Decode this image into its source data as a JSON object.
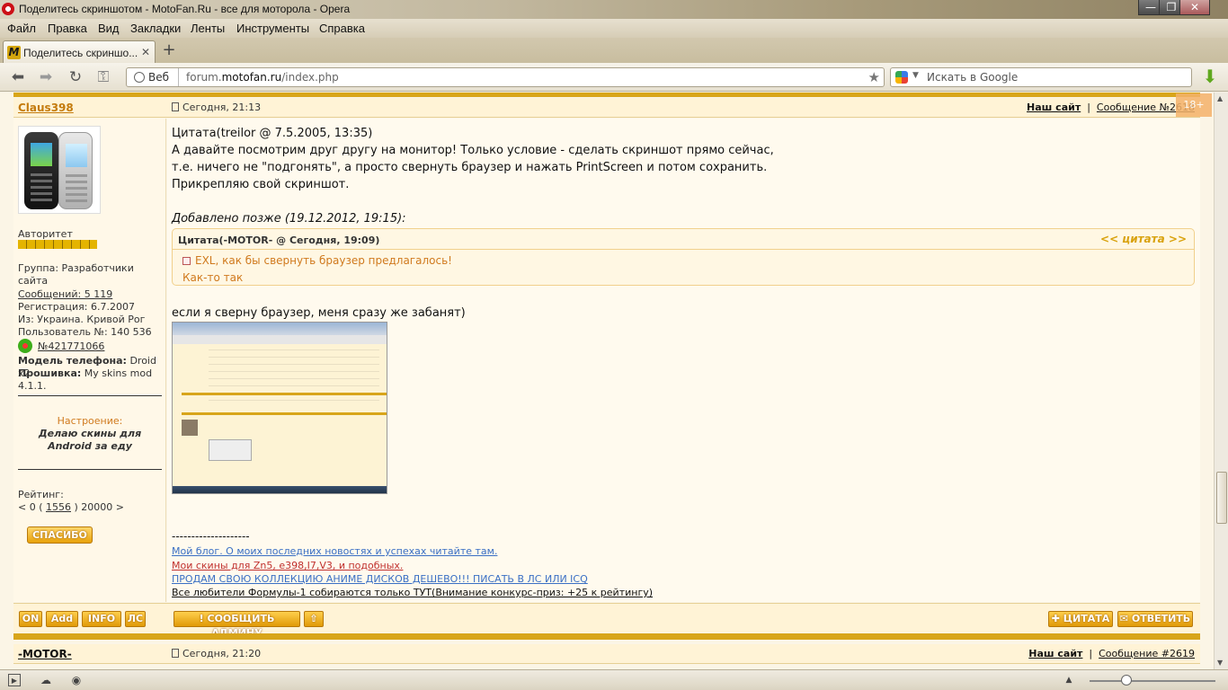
{
  "window": {
    "title": "Поделитесь скриншотом - MotoFan.Ru - все для моторола - Opera"
  },
  "menu": [
    "Файл",
    "Правка",
    "Вид",
    "Закладки",
    "Ленты",
    "Инструменты",
    "Справка"
  ],
  "tab": {
    "label": "Поделитесь скриншо...",
    "favicon_letter": "M"
  },
  "address": {
    "mode": "Веб",
    "url_prefix": "forum.",
    "url_domain": "motofan.ru",
    "url_path": "/index.php"
  },
  "search": {
    "placeholder": "Искать в Google"
  },
  "badge": "18+",
  "post1": {
    "author": "Claus398",
    "date": "Сегодня, 21:13",
    "site_link": "Наш сайт",
    "message_num": "Сообщение №2618",
    "rank_label": "Авторитет",
    "group": "Группа: Разработчики сайта",
    "messages": "Сообщений: 5 119",
    "registered": "Регистрация: 6.7.2007",
    "from": "Из: Украина. Кривой Рог",
    "user_num": "Пользователь №: 140 536",
    "icq": "№421771066",
    "phone_label": "Модель телефона:",
    "phone_value": "Droid x2",
    "firmware_label": "Прошивка:",
    "firmware_value": "My skins mod 4.1.1.",
    "mood_label": "Настроение:",
    "mood": "Делаю скины для Android за еду",
    "rating_label": "Рейтинг:",
    "rating_pre": "< 0 ( ",
    "rating_value": "1556",
    "rating_post": " ) 20000 >",
    "thanks": "СПАСИБО",
    "body": {
      "quote_line": "Цитата(treilor @ 7.5.2005, 13:35)",
      "line1": "А давайте посмотрим друг другу на монитор! Только условие - сделать скриншот прямо сейчас,",
      "line2": "т.е. ничего не \"подгонять\", а просто свернуть браузер и нажать PrintScreen и потом сохранить.",
      "line3": "Прикрепляю свой скриншот.",
      "added_later": "Добавлено позже (19.12.2012, 19:15):",
      "inner_quote_head": "Цитата(-MOTOR- @ Сегодня, 19:09)",
      "inner_quote_link": "<< цитата >>",
      "inner_quote_l1": "EXL, как бы свернуть браузер предлагалось!",
      "inner_quote_l2": "Как-то так",
      "reply": "если я сверну браузер, меня сразу же забанят)"
    },
    "signature": {
      "dashes": "--------------------",
      "blog": "Мой блог. О моих последних новостях и успехах читайте там.",
      "skins": "Мои скины для Zn5, e398,I7,V3, и подобных.",
      "anime": "ПРОДАМ СВОЮ КОЛЛЕКЦИЮ АНИМЕ ДИСКОВ ДЕШЕВО!!! ПИСАТЬ В ЛС ИЛИ ICQ",
      "f1": "Все любители Формулы-1 собираются только ТУТ(Внимание конкурс-приз: +25 к рейтингу)"
    },
    "footer": {
      "on": "ON",
      "add": "Add",
      "info": "INFO",
      "ls": "ЛС",
      "report": "! СООБЩИТЬ АДМИНУ",
      "up": "⇧",
      "quote": "✚ ЦИТАТА",
      "reply": "✉ ОТВЕТИТЬ"
    }
  },
  "post2": {
    "author": "-MOTOR-",
    "date": "Сегодня, 21:20",
    "site_link": "Наш сайт",
    "message_num": "Сообщение #2619"
  }
}
